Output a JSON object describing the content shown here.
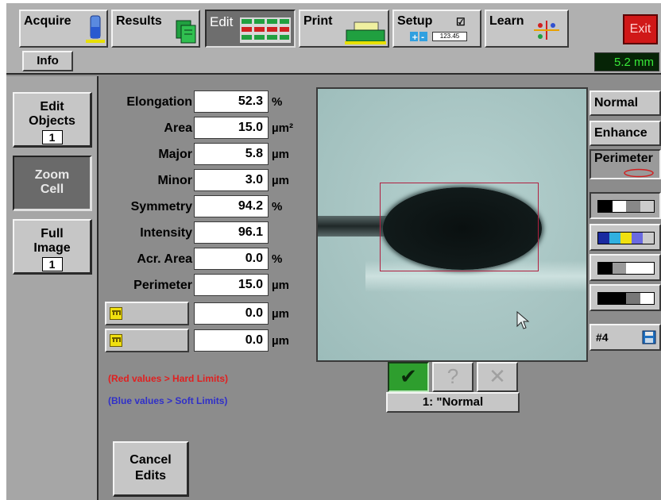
{
  "toolbar": {
    "tabs": [
      {
        "label": "Acquire"
      },
      {
        "label": "Results"
      },
      {
        "label": "Edit"
      },
      {
        "label": "Print"
      },
      {
        "label": "Setup"
      },
      {
        "label": "Learn"
      }
    ],
    "active_tab": "Edit",
    "setup_icon_readout": "123.45",
    "info_label": "Info",
    "exit_label": "Exit",
    "scale_readout": "5.2 mm"
  },
  "left_panel": {
    "buttons": [
      {
        "label": "Edit Objects",
        "count": "1"
      },
      {
        "label": "Zoom Cell"
      },
      {
        "label": "Full Image",
        "count": "1"
      }
    ],
    "active": "Zoom Cell"
  },
  "measurements": [
    {
      "label": "Elongation",
      "value": "52.3",
      "unit": "%"
    },
    {
      "label": "Area",
      "value": "15.0",
      "unit": "µm²"
    },
    {
      "label": "Major",
      "value": "5.8",
      "unit": "µm"
    },
    {
      "label": "Minor",
      "value": "3.0",
      "unit": "µm"
    },
    {
      "label": "Symmetry",
      "value": "94.2",
      "unit": "%"
    },
    {
      "label": "Intensity",
      "value": "96.1",
      "unit": ""
    },
    {
      "label": "Acr. Area",
      "value": "0.0",
      "unit": "%"
    },
    {
      "label": "Perimeter",
      "value": "15.0",
      "unit": "µm"
    }
  ],
  "custom_measurements": [
    {
      "value": "0.0",
      "unit": "µm"
    },
    {
      "value": "0.0",
      "unit": "µm"
    }
  ],
  "legend": {
    "red": "(Red values > Hard Limits)",
    "blue": "(Blue values > Soft Limits)",
    "red_color": "#e02020",
    "blue_color": "#3030c8"
  },
  "cancel_label": "Cancel Edits",
  "view_modes": [
    "Normal",
    "Enhance",
    "Perimeter"
  ],
  "active_view_mode": "Perimeter",
  "lut_palettes": [
    "grayscale-lut-1",
    "color-lut",
    "grayscale-lut-2",
    "grayscale-lut-3"
  ],
  "image_number": "#4",
  "status_buttons": [
    {
      "icon": "check-icon",
      "glyph": "✔"
    },
    {
      "icon": "question-icon",
      "glyph": "?"
    },
    {
      "icon": "x-icon",
      "glyph": "✕"
    }
  ],
  "classification_label": "1: \"Normal",
  "colors": {
    "accept_green": "#2e9e2e",
    "exit_red": "#d01818",
    "readout_green": "#38e838",
    "bbox_red": "#b02040"
  }
}
